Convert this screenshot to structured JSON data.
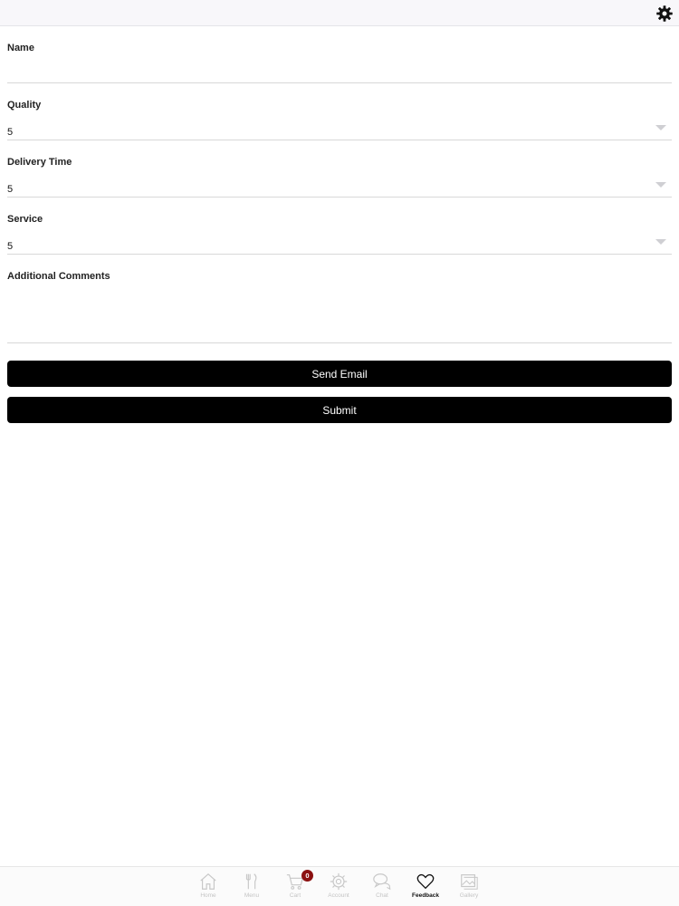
{
  "settings_icon": "gear-icon",
  "form": {
    "name": {
      "label": "Name",
      "value": ""
    },
    "quality": {
      "label": "Quality",
      "value": "5"
    },
    "delivery_time": {
      "label": "Delivery Time",
      "value": "5"
    },
    "service": {
      "label": "Service",
      "value": "5"
    },
    "comments": {
      "label": "Additional Comments",
      "value": ""
    }
  },
  "buttons": {
    "send_email": "Send Email",
    "submit": "Submit"
  },
  "tabbar": {
    "active": "Feedback",
    "cart_count": "0",
    "items": [
      {
        "label": "Home",
        "icon": "home-icon"
      },
      {
        "label": "Menu",
        "icon": "utensils-icon"
      },
      {
        "label": "Cart",
        "icon": "cart-icon"
      },
      {
        "label": "Account",
        "icon": "gear-icon"
      },
      {
        "label": "Chat",
        "icon": "chat-icon"
      },
      {
        "label": "Feedback",
        "icon": "heart-icon"
      },
      {
        "label": "Gallery",
        "icon": "gallery-icon"
      }
    ]
  },
  "colors": {
    "button_bg": "#000000",
    "badge": "#8b1010",
    "inactive_tab": "#c4c4c4"
  }
}
